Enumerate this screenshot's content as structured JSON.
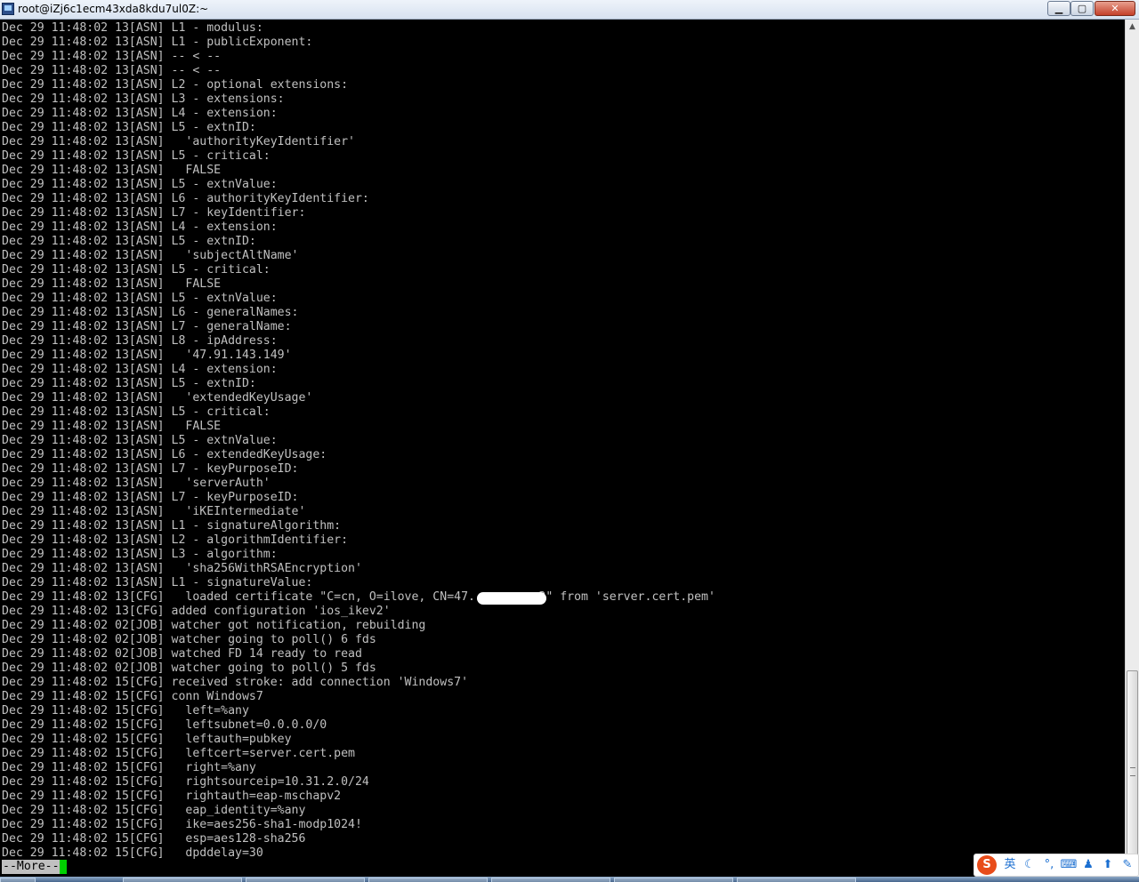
{
  "window": {
    "title": "root@iZj6c1ecm43xda8kdu7ul0Z:~",
    "buttons": {
      "minimize": "▁",
      "maximize": "▢",
      "close": "✕"
    }
  },
  "terminal": {
    "lines": [
      "Dec 29 11:48:02 13[ASN] L1 - modulus:",
      "Dec 29 11:48:02 13[ASN] L1 - publicExponent:",
      "Dec 29 11:48:02 13[ASN] -- < --",
      "Dec 29 11:48:02 13[ASN] -- < --",
      "Dec 29 11:48:02 13[ASN] L2 - optional extensions:",
      "Dec 29 11:48:02 13[ASN] L3 - extensions:",
      "Dec 29 11:48:02 13[ASN] L4 - extension:",
      "Dec 29 11:48:02 13[ASN] L5 - extnID:",
      "Dec 29 11:48:02 13[ASN]   'authorityKeyIdentifier'",
      "Dec 29 11:48:02 13[ASN] L5 - critical:",
      "Dec 29 11:48:02 13[ASN]   FALSE",
      "Dec 29 11:48:02 13[ASN] L5 - extnValue:",
      "Dec 29 11:48:02 13[ASN] L6 - authorityKeyIdentifier:",
      "Dec 29 11:48:02 13[ASN] L7 - keyIdentifier:",
      "Dec 29 11:48:02 13[ASN] L4 - extension:",
      "Dec 29 11:48:02 13[ASN] L5 - extnID:",
      "Dec 29 11:48:02 13[ASN]   'subjectAltName'",
      "Dec 29 11:48:02 13[ASN] L5 - critical:",
      "Dec 29 11:48:02 13[ASN]   FALSE",
      "Dec 29 11:48:02 13[ASN] L5 - extnValue:",
      "Dec 29 11:48:02 13[ASN] L6 - generalNames:",
      "Dec 29 11:48:02 13[ASN] L7 - generalName:",
      "Dec 29 11:48:02 13[ASN] L8 - ipAddress:",
      "Dec 29 11:48:02 13[ASN]   '47.91.143.149'",
      "Dec 29 11:48:02 13[ASN] L4 - extension:",
      "Dec 29 11:48:02 13[ASN] L5 - extnID:",
      "Dec 29 11:48:02 13[ASN]   'extendedKeyUsage'",
      "Dec 29 11:48:02 13[ASN] L5 - critical:",
      "Dec 29 11:48:02 13[ASN]   FALSE",
      "Dec 29 11:48:02 13[ASN] L5 - extnValue:",
      "Dec 29 11:48:02 13[ASN] L6 - extendedKeyUsage:",
      "Dec 29 11:48:02 13[ASN] L7 - keyPurposeID:",
      "Dec 29 11:48:02 13[ASN]   'serverAuth'",
      "Dec 29 11:48:02 13[ASN] L7 - keyPurposeID:",
      "Dec 29 11:48:02 13[ASN]   'iKEIntermediate'",
      "Dec 29 11:48:02 13[ASN] L1 - signatureAlgorithm:",
      "Dec 29 11:48:02 13[ASN] L2 - algorithmIdentifier:",
      "Dec 29 11:48:02 13[ASN] L3 - algorithm:",
      "Dec 29 11:48:02 13[ASN]   'sha256WithRSAEncryption'",
      "Dec 29 11:48:02 13[ASN] L1 - signatureValue:",
      "Dec 29 11:48:02 13[CFG]   loaded certificate \"C=cn, O=ilove, CN=47.         3\" from 'server.cert.pem'",
      "Dec 29 11:48:02 13[CFG] added configuration 'ios_ikev2'",
      "Dec 29 11:48:02 02[JOB] watcher got notification, rebuilding",
      "Dec 29 11:48:02 02[JOB] watcher going to poll() 6 fds",
      "Dec 29 11:48:02 02[JOB] watched FD 14 ready to read",
      "Dec 29 11:48:02 02[JOB] watcher going to poll() 5 fds",
      "Dec 29 11:48:02 15[CFG] received stroke: add connection 'Windows7'",
      "Dec 29 11:48:02 15[CFG] conn Windows7",
      "Dec 29 11:48:02 15[CFG]   left=%any",
      "Dec 29 11:48:02 15[CFG]   leftsubnet=0.0.0.0/0",
      "Dec 29 11:48:02 15[CFG]   leftauth=pubkey",
      "Dec 29 11:48:02 15[CFG]   leftcert=server.cert.pem",
      "Dec 29 11:48:02 15[CFG]   right=%any",
      "Dec 29 11:48:02 15[CFG]   rightsourceip=10.31.2.0/24",
      "Dec 29 11:48:02 15[CFG]   rightauth=eap-mschapv2",
      "Dec 29 11:48:02 15[CFG]   eap_identity=%any",
      "Dec 29 11:48:02 15[CFG]   ike=aes256-sha1-modp1024!",
      "Dec 29 11:48:02 15[CFG]   esp=aes128-sha256",
      "Dec 29 11:48:02 15[CFG]   dpddelay=30"
    ],
    "pager_prompt": "--More--",
    "text_color": "#c0c0c0",
    "cursor_color": "#00d000"
  },
  "ime": {
    "logo": "S",
    "mode": "英",
    "items": [
      "moon-icon",
      "punctuation-icon",
      "keyboard-icon",
      "user-icon",
      "shirt-icon",
      "wrench-icon"
    ],
    "glyphs": [
      "☾",
      "°,",
      "⌨",
      "♟",
      "⬆",
      "✎"
    ]
  }
}
